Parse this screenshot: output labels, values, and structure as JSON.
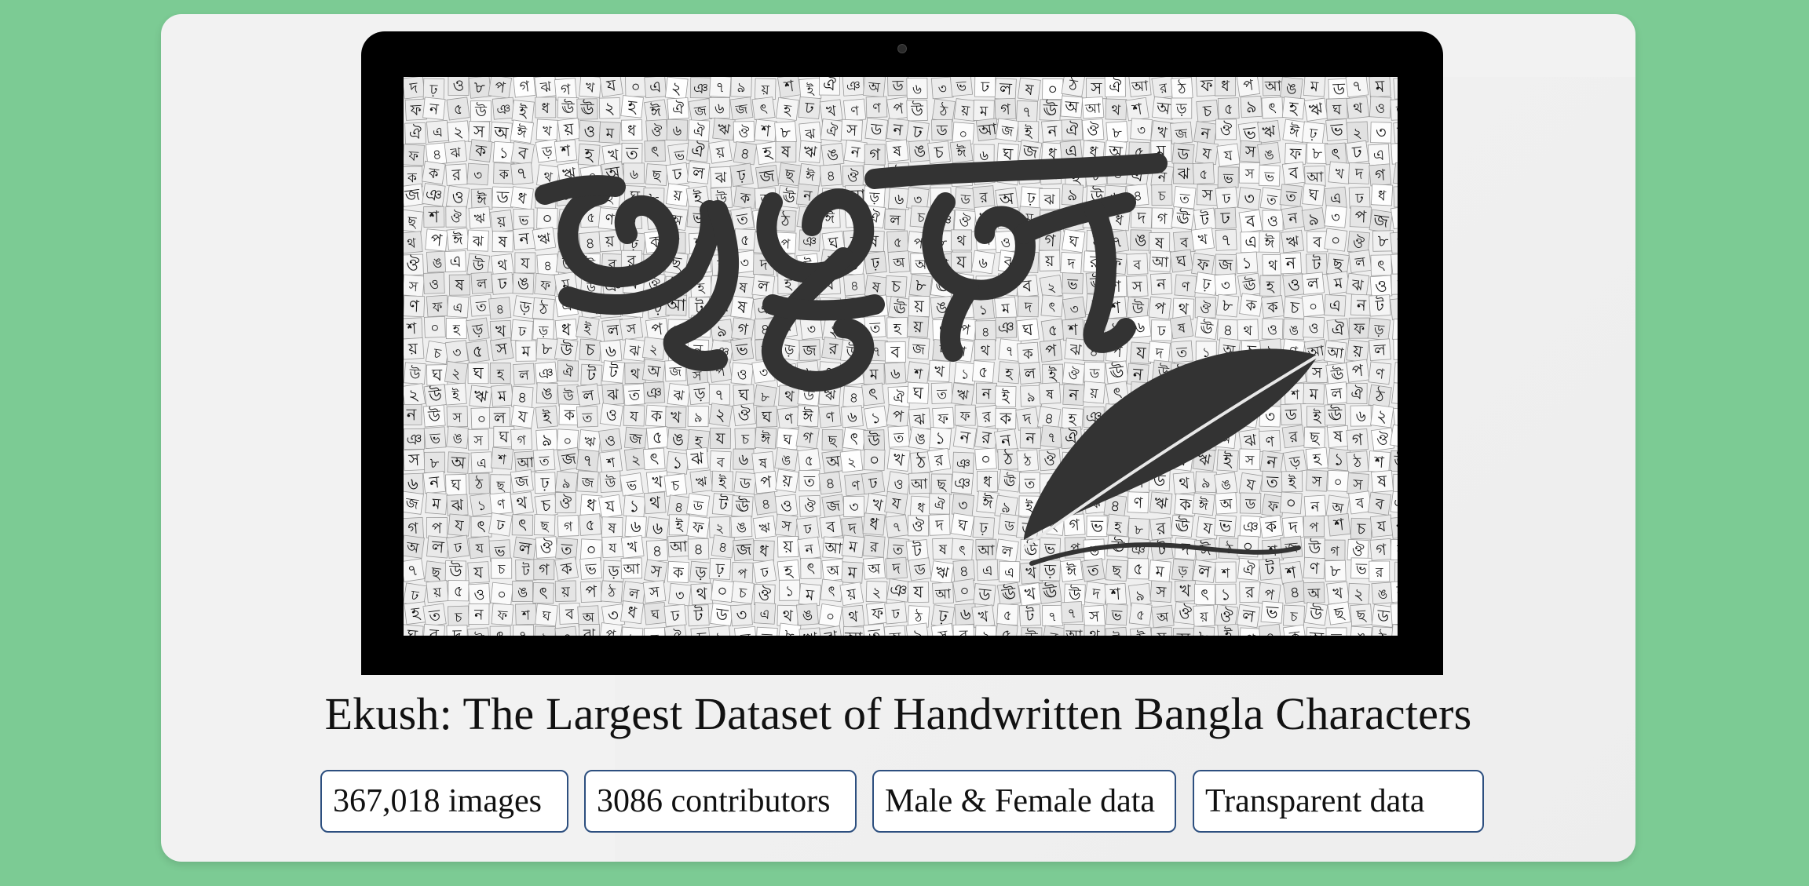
{
  "hero": {
    "title": "Ekush: The Largest Dataset of Handwritten Bangla Characters",
    "artwork": {
      "logo_text": "একুশ",
      "mosaic_glyphs": [
        "অ",
        "আ",
        "ই",
        "ঈ",
        "উ",
        "ঊ",
        "ঋ",
        "এ",
        "ঐ",
        "ও",
        "ঔ",
        "ক",
        "খ",
        "গ",
        "ঘ",
        "ঙ",
        "চ",
        "ছ",
        "জ",
        "ঝ",
        "ঞ",
        "ট",
        "ঠ",
        "ড",
        "ঢ",
        "ণ",
        "ত",
        "থ",
        "দ",
        "ধ",
        "ন",
        "প",
        "ফ",
        "ব",
        "ভ",
        "ম",
        "য",
        "র",
        "ল",
        "শ",
        "ষ",
        "স",
        "হ",
        "ড়",
        "ঢ়",
        "য়",
        "ৎ",
        "০",
        "১",
        "২",
        "৩",
        "৪",
        "৫",
        "৬",
        "৭",
        "৮",
        "৯"
      ]
    }
  },
  "features": [
    {
      "label": "367,018 images"
    },
    {
      "label": "3086 contributors"
    },
    {
      "label": "Male & Female data"
    },
    {
      "label": "Transparent data"
    }
  ],
  "colors": {
    "background": "#7ccb94",
    "card": "#f2f2f2",
    "badge_border": "#2d4f7f",
    "ink": "#333333"
  }
}
